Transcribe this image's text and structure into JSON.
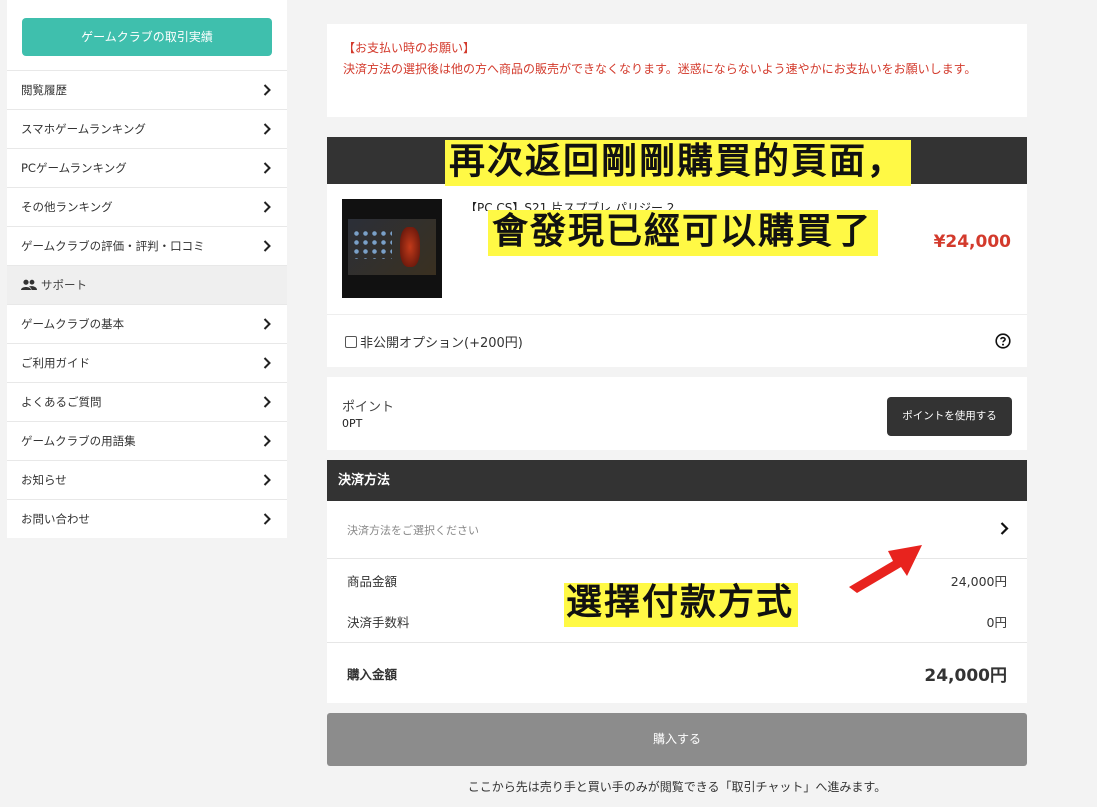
{
  "sidebar": {
    "track_button": "ゲームクラブの取引実績",
    "items": [
      {
        "label": "閲覧履歴"
      },
      {
        "label": "スマホゲームランキング"
      },
      {
        "label": "PCゲームランキング"
      },
      {
        "label": "その他ランキング"
      },
      {
        "label": "ゲームクラブの評価・評判・口コミ"
      }
    ],
    "section": {
      "label": "サポート",
      "icon": "people-icon"
    },
    "support_items": [
      {
        "label": "ゲームクラブの基本"
      },
      {
        "label": "ご利用ガイド"
      },
      {
        "label": "よくあるご質問"
      },
      {
        "label": "ゲームクラブの用語集"
      },
      {
        "label": "お知らせ"
      },
      {
        "label": "お問い合わせ"
      }
    ]
  },
  "notice": {
    "title": "【お支払い時のお願い】",
    "body": "決済方法の選択後は他の方へ商品の販売ができなくなります。迷惑にならないよう速やかにお支払いをお願いします。"
  },
  "product": {
    "title": "【PC CS】S21 片スプブレ パリジー 2",
    "price": "¥24,000",
    "option_label": "非公開オプション(+200円)"
  },
  "points": {
    "label": "ポイント",
    "value": "0PT",
    "use_button": "ポイントを使用する"
  },
  "payment": {
    "header": "決済方法",
    "placeholder": "決済方法をご選択ください",
    "rows": [
      {
        "label": "商品金額",
        "value": "24,000円"
      },
      {
        "label": "決済手数料",
        "value": "0円"
      }
    ],
    "total_label": "購入金額",
    "total_value": "24,000円"
  },
  "buy_button": "購入する",
  "footnote": "ここから先は売り手と買い手のみが閲覧できる「取引チャット」へ進みます。",
  "overlay": {
    "caption1": "再次返回剛剛購買的頁面，",
    "caption2": "會發現已經可以購買了",
    "caption3": "選擇付款方式"
  },
  "colors": {
    "accent": "#3fbfad",
    "price_red": "#d33a2c",
    "dark": "#333333",
    "caption_bg": "#fff945",
    "arrow": "#e8231e"
  }
}
